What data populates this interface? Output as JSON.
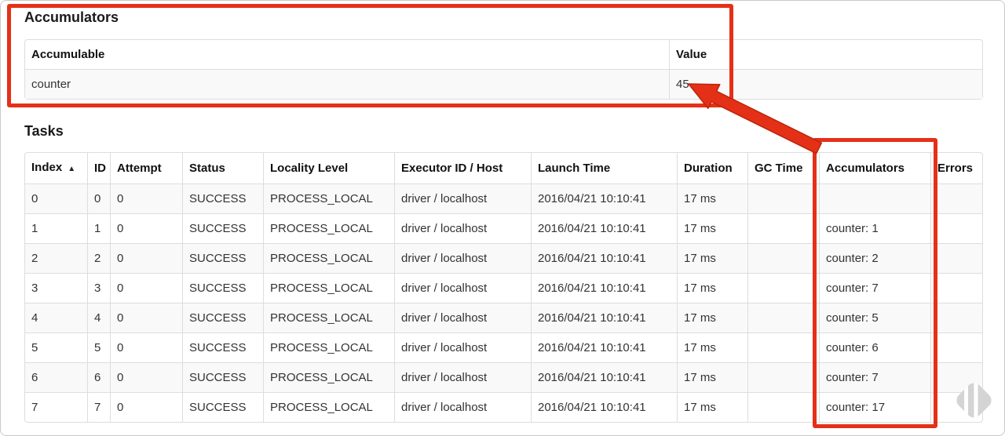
{
  "colors": {
    "annotation_red": "#e53018",
    "table_border": "#dddddd",
    "row_stripe": "#f9f9f9",
    "text": "#333333"
  },
  "accumulators_section": {
    "heading": "Accumulators",
    "table": {
      "headers": [
        "Accumulable",
        "Value"
      ],
      "rows": [
        [
          "counter",
          "45"
        ]
      ]
    }
  },
  "tasks_section": {
    "heading": "Tasks",
    "table": {
      "sort_icon": "▲",
      "headers": [
        "Index",
        "ID",
        "Attempt",
        "Status",
        "Locality Level",
        "Executor ID / Host",
        "Launch Time",
        "Duration",
        "GC Time",
        "Accumulators",
        "Errors"
      ],
      "rows": [
        [
          "0",
          "0",
          "0",
          "SUCCESS",
          "PROCESS_LOCAL",
          "driver / localhost",
          "2016/04/21 10:10:41",
          "17 ms",
          "",
          "",
          ""
        ],
        [
          "1",
          "1",
          "0",
          "SUCCESS",
          "PROCESS_LOCAL",
          "driver / localhost",
          "2016/04/21 10:10:41",
          "17 ms",
          "",
          "counter: 1",
          ""
        ],
        [
          "2",
          "2",
          "0",
          "SUCCESS",
          "PROCESS_LOCAL",
          "driver / localhost",
          "2016/04/21 10:10:41",
          "17 ms",
          "",
          "counter: 2",
          ""
        ],
        [
          "3",
          "3",
          "0",
          "SUCCESS",
          "PROCESS_LOCAL",
          "driver / localhost",
          "2016/04/21 10:10:41",
          "17 ms",
          "",
          "counter: 7",
          ""
        ],
        [
          "4",
          "4",
          "0",
          "SUCCESS",
          "PROCESS_LOCAL",
          "driver / localhost",
          "2016/04/21 10:10:41",
          "17 ms",
          "",
          "counter: 5",
          ""
        ],
        [
          "5",
          "5",
          "0",
          "SUCCESS",
          "PROCESS_LOCAL",
          "driver / localhost",
          "2016/04/21 10:10:41",
          "17 ms",
          "",
          "counter: 6",
          ""
        ],
        [
          "6",
          "6",
          "0",
          "SUCCESS",
          "PROCESS_LOCAL",
          "driver / localhost",
          "2016/04/21 10:10:41",
          "17 ms",
          "",
          "counter: 7",
          ""
        ],
        [
          "7",
          "7",
          "0",
          "SUCCESS",
          "PROCESS_LOCAL",
          "driver / localhost",
          "2016/04/21 10:10:41",
          "17 ms",
          "",
          "counter: 17",
          ""
        ]
      ]
    }
  },
  "annotations": {
    "arrow_icon": "red-arrow",
    "watermark_icon": "feedly-diamond-logo"
  }
}
